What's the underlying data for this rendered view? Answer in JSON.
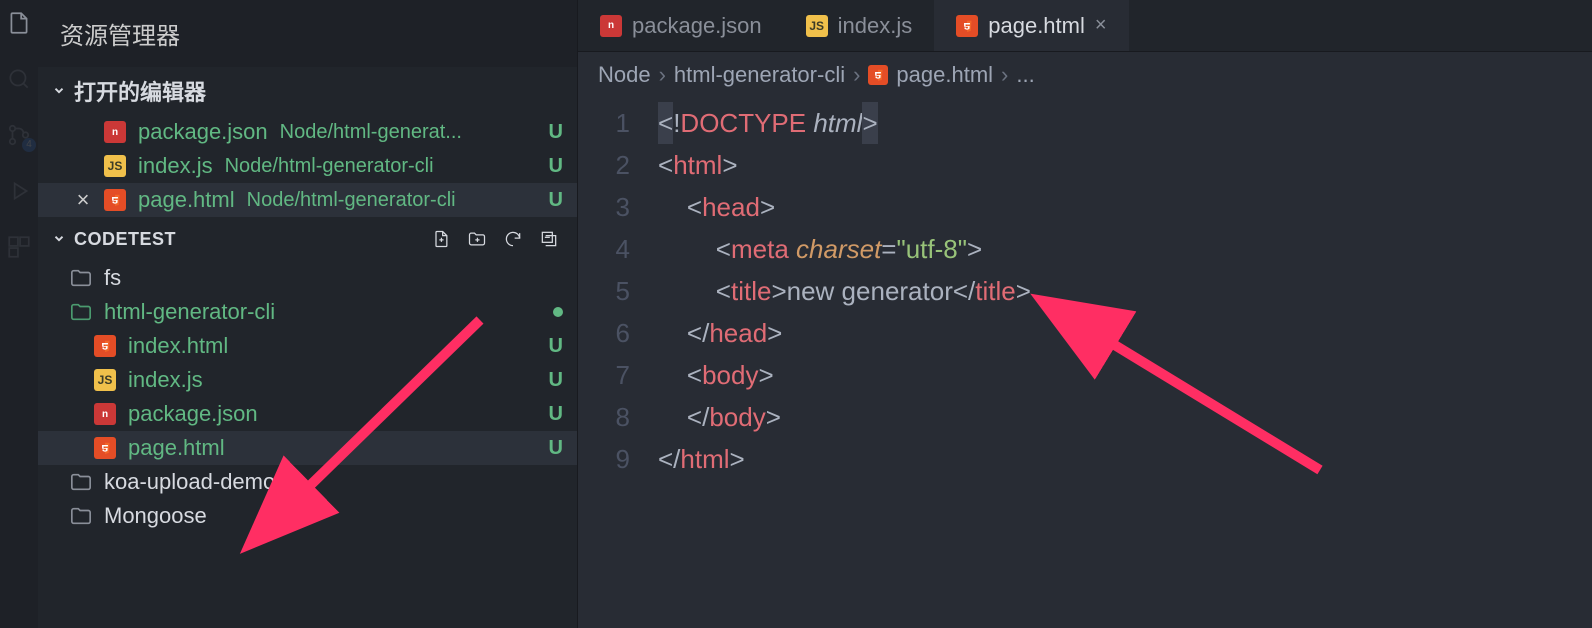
{
  "explorer": {
    "title": "资源管理器",
    "openEditorsLabel": "打开的编辑器",
    "workspaceLabel": "CODETEST",
    "badge": "4",
    "openEditors": [
      {
        "icon": "npm",
        "name": "package.json",
        "path": "Node/html-generat...",
        "badge": "U",
        "active": false,
        "close": ""
      },
      {
        "icon": "js",
        "name": "index.js",
        "path": "Node/html-generator-cli",
        "badge": "U",
        "active": false,
        "close": ""
      },
      {
        "icon": "html5",
        "name": "page.html",
        "path": "Node/html-generator-cli",
        "badge": "U",
        "active": true,
        "close": "×"
      }
    ],
    "tree": [
      {
        "type": "folder",
        "name": "fs",
        "depth": 1,
        "mod": false,
        "badge": ""
      },
      {
        "type": "folder",
        "name": "html-generator-cli",
        "depth": 1,
        "mod": true,
        "dot": true
      },
      {
        "type": "file",
        "icon": "html5",
        "name": "index.html",
        "depth": 2,
        "mod": true,
        "badge": "U"
      },
      {
        "type": "file",
        "icon": "js",
        "name": "index.js",
        "depth": 2,
        "mod": true,
        "badge": "U"
      },
      {
        "type": "file",
        "icon": "npm",
        "name": "package.json",
        "depth": 2,
        "mod": true,
        "badge": "U"
      },
      {
        "type": "file",
        "icon": "html5",
        "name": "page.html",
        "depth": 2,
        "mod": true,
        "badge": "U",
        "active": true
      },
      {
        "type": "folder",
        "name": "koa-upload-demo",
        "depth": 1,
        "mod": false
      },
      {
        "type": "folder",
        "name": "Mongoose",
        "depth": 1,
        "mod": false
      }
    ]
  },
  "tabs": [
    {
      "icon": "npm",
      "label": "package.json",
      "active": false
    },
    {
      "icon": "js",
      "label": "index.js",
      "active": false
    },
    {
      "icon": "html5",
      "label": "page.html",
      "active": true,
      "close": "×"
    }
  ],
  "breadcrumb": {
    "parts": [
      "Node",
      "html-generator-cli",
      "page.html",
      "..."
    ],
    "fileIcon": "html5"
  },
  "code": {
    "lines": [
      1,
      2,
      3,
      4,
      5,
      6,
      7,
      8,
      9
    ],
    "content": {
      "doctype_pre": "<!",
      "doctype": "DOCTYPE",
      "doctype_kw": " html",
      "doctype_post": ">",
      "html_open": "html",
      "head_open": "head",
      "meta": "meta",
      "charset_attr": "charset",
      "charset_eq": "=",
      "charset_val": "\"utf-8\"",
      "title": "title",
      "title_text": "new generator",
      "head_close": "head",
      "body": "body",
      "html_close": "html"
    }
  }
}
